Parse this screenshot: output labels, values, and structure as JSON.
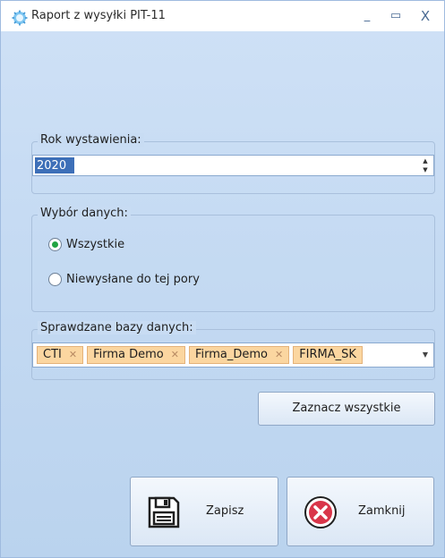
{
  "window": {
    "title": "Raport z wysyłki PIT-11",
    "minimize": "_",
    "maximize": "▭",
    "close": "X"
  },
  "year_group": {
    "label": "Rok wystawienia:",
    "value": "2020"
  },
  "data_group": {
    "label": "Wybór danych:",
    "options": [
      {
        "label": "Wszystkie",
        "selected": true
      },
      {
        "label": "Niewysłane do tej pory",
        "selected": false
      }
    ]
  },
  "db_group": {
    "label": "Sprawdzane bazy danych:",
    "tags": [
      "CTI",
      "Firma Demo",
      "Firma_Demo",
      "FIRMA_SK"
    ]
  },
  "buttons": {
    "select_all": "Zaznacz wszystkie",
    "save": "Zapisz",
    "close": "Zamknij"
  },
  "colors": {
    "accent": "#3d6fb8",
    "tag_bg": "#fbd6a0",
    "radio_on": "#22a442",
    "close_icon": "#d9364a"
  }
}
